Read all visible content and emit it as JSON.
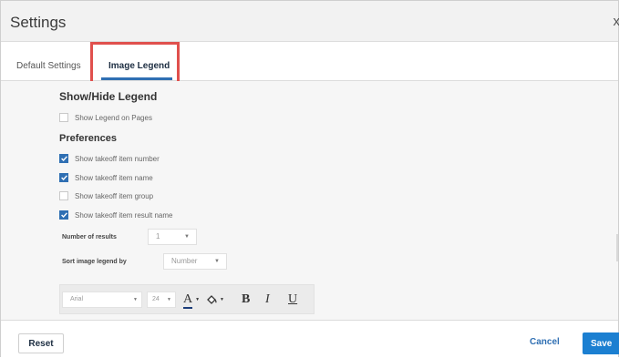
{
  "dialog": {
    "title": "Settings",
    "close_glyph": "x"
  },
  "tabs": [
    {
      "label": "Default Settings",
      "active": false
    },
    {
      "label": "Image Legend",
      "active": true
    }
  ],
  "help_glyph": "?",
  "show_hide": {
    "heading": "Show/Hide Legend",
    "show_on_pages": {
      "label": "Show Legend on Pages",
      "checked": false
    }
  },
  "preferences": {
    "heading": "Preferences",
    "options": [
      {
        "label": "Show takeoff item number",
        "checked": true
      },
      {
        "label": "Show takeoff item name",
        "checked": true
      },
      {
        "label": "Show takeoff item group",
        "checked": false
      },
      {
        "label": "Show takeoff item result name",
        "checked": true
      }
    ]
  },
  "number_of_results": {
    "label": "Number of results",
    "value": "1"
  },
  "sort_by": {
    "label": "Sort image legend by",
    "value": "Number"
  },
  "toolbar": {
    "font_family": "Arial",
    "font_size": "24",
    "font_color_glyph": "A",
    "bold_glyph": "B",
    "italic_glyph": "I",
    "underline_glyph": "U"
  },
  "footer": {
    "reset_label": "Reset",
    "cancel_label": "Cancel",
    "save_label": "Save"
  },
  "colors": {
    "accent": "#2f6fb3",
    "save": "#1b7fd1",
    "highlight": "#e0504d",
    "font_color_bar": "#1b3d7a"
  },
  "icons": {
    "close": "close-icon",
    "help": "help-icon",
    "dropdown": "chevron-down-icon",
    "fill": "paint-bucket-icon"
  }
}
